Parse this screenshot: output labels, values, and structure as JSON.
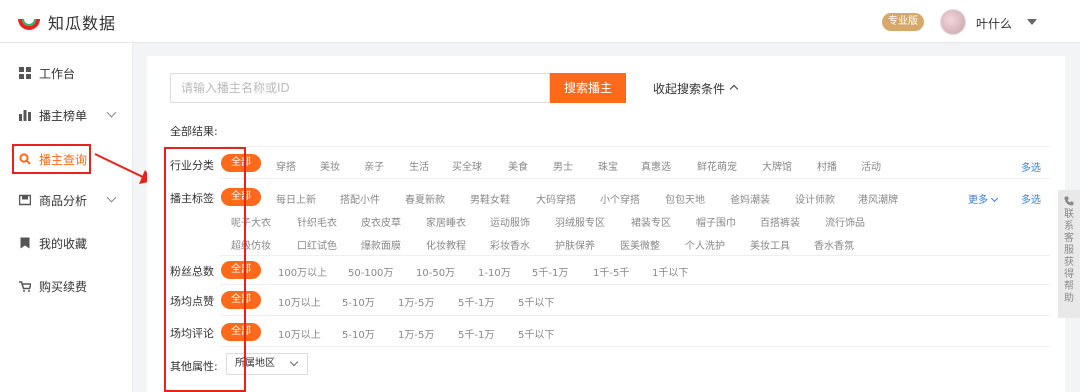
{
  "app": {
    "name": "知瓜数据",
    "brand_color": "#ff6a1a",
    "logo_icon": "watermelon-logo-icon"
  },
  "header": {
    "pro_badge": "专业版",
    "user_name": "叶什么"
  },
  "sidebar": {
    "items": [
      {
        "label": "工作台",
        "icon": "grid-icon"
      },
      {
        "label": "播主榜单",
        "icon": "bar-chart-icon"
      },
      {
        "label": "播主查询",
        "icon": "search-icon"
      },
      {
        "label": "商品分析",
        "icon": "box-icon"
      },
      {
        "label": "我的收藏",
        "icon": "bookmark-icon"
      },
      {
        "label": "购买续费",
        "icon": "cart-icon"
      }
    ]
  },
  "search": {
    "placeholder": "请输入播主名称或ID",
    "button": "搜索播主",
    "collapse": "收起搜索条件"
  },
  "all_results": "全部结果:",
  "filters": {
    "industry": {
      "label": "行业分类",
      "all": "全部",
      "options": [
        "穿搭",
        "美妆",
        "亲子",
        "生活",
        "买全球",
        "美食",
        "男士",
        "珠宝",
        "真惠选",
        "鲜花萌宠",
        "大牌馆",
        "村播",
        "活动"
      ],
      "multi": "多选"
    },
    "tags": {
      "label": "播主标签",
      "all": "全部",
      "line1": [
        "每日上新",
        "搭配小件",
        "春夏新款",
        "男鞋女鞋",
        "大码穿搭",
        "小个穿搭",
        "包包天地",
        "爸妈潮装",
        "设计师款",
        "港风潮牌"
      ],
      "line2": [
        "呢子大衣",
        "针织毛衣",
        "皮衣皮草",
        "家居睡衣",
        "运动服饰",
        "羽绒服专区",
        "裙装专区",
        "帽子围巾",
        "百搭裤装",
        "流行饰品"
      ],
      "line3": [
        "超级仿妆",
        "口红试色",
        "爆款面膜",
        "化妆教程",
        "彩妆香水",
        "护肤保养",
        "医美微整",
        "个人洗护",
        "美妆工具",
        "香水香氛"
      ],
      "more": "更多",
      "multi": "多选"
    },
    "fans": {
      "label": "粉丝总数",
      "all": "全部",
      "options": [
        "100万以上",
        "50-100万",
        "10-50万",
        "1-10万",
        "5千-1万",
        "1千-5千",
        "1千以下"
      ]
    },
    "likes": {
      "label": "场均点赞",
      "all": "全部",
      "options": [
        "10万以上",
        "5-10万",
        "1万-5万",
        "5千-1万",
        "5千以下"
      ]
    },
    "comments": {
      "label": "场均评论",
      "all": "全部",
      "options": [
        "10万以上",
        "5-10万",
        "1万-5万",
        "5千-1万",
        "5千以下"
      ]
    },
    "other": {
      "label": "其他属性:",
      "region": "所属地区"
    }
  },
  "help_tab": {
    "text": "联系客服获得帮助"
  },
  "annotation_color": "#e8231c"
}
